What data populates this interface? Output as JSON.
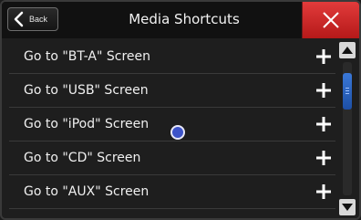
{
  "header": {
    "back_label": "Back",
    "title": "Media Shortcuts"
  },
  "items": [
    {
      "label": "Go to \"BT-A\" Screen"
    },
    {
      "label": "Go to \"USB\" Screen"
    },
    {
      "label": "Go to \"iPod\" Screen"
    },
    {
      "label": "Go to \"CD\" Screen"
    },
    {
      "label": "Go to \"AUX\" Screen"
    }
  ],
  "colors": {
    "close_button": "#d32f2f",
    "scroll_thumb": "#2a63c0",
    "cursor": "#3d53c8"
  },
  "icons": {
    "back": "chevron-left-icon",
    "close": "close-icon",
    "add": "plus-icon",
    "scroll_up": "triangle-up-icon",
    "scroll_down": "triangle-down-icon"
  }
}
